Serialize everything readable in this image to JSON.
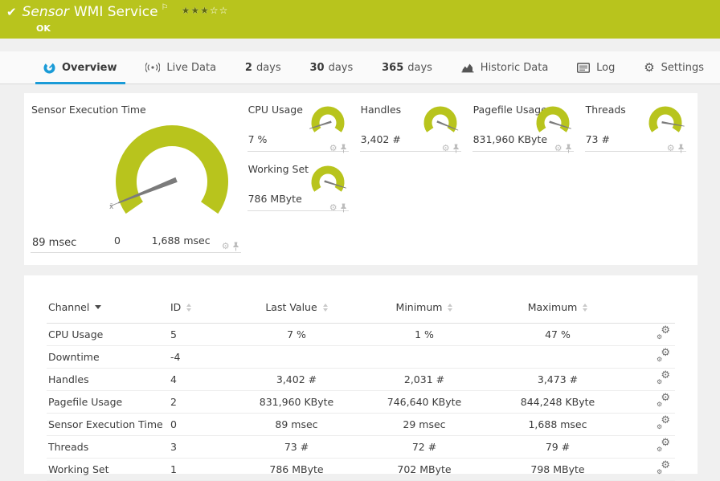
{
  "header": {
    "check_glyph": "✔",
    "title_prefix": "Sensor",
    "title": "WMI Service",
    "flag_glyph": "⚐",
    "status": "OK",
    "rating": {
      "filled": 3,
      "total": 5
    }
  },
  "tabs": [
    {
      "id": "overview",
      "icon": "gauge",
      "label": "Overview",
      "active": true
    },
    {
      "id": "live-data",
      "icon": "live",
      "label": "Live Data"
    },
    {
      "id": "2-days",
      "prefix": "2",
      "label": "days"
    },
    {
      "id": "30-days",
      "prefix": "30",
      "label": "days"
    },
    {
      "id": "365-days",
      "prefix": "365",
      "label": "days"
    },
    {
      "id": "historic-data",
      "icon": "chart",
      "label": "Historic Data"
    },
    {
      "id": "log",
      "icon": "log",
      "label": "Log"
    },
    {
      "id": "settings",
      "icon": "gear",
      "label": "Settings"
    }
  ],
  "gauges": {
    "primary": {
      "title": "Sensor Execution Time",
      "value": "89 msec",
      "min_label": "0",
      "max_label": "1,688 msec",
      "mean_glyph": "x̄",
      "fraction": 0.053
    },
    "small": [
      {
        "title": "CPU Usage",
        "value": "7 %",
        "fraction": 0.07
      },
      {
        "title": "Handles",
        "value": "3,402 #",
        "fraction": 0.95
      },
      {
        "title": "Pagefile Usage",
        "value": "831,960 KByte",
        "fraction": 0.93
      },
      {
        "title": "Threads",
        "value": "73 #",
        "fraction": 0.9
      },
      {
        "title": "Working Set",
        "value": "786 MByte",
        "fraction": 0.93
      }
    ]
  },
  "chart_data": {
    "type": "gauge",
    "gauges": [
      {
        "name": "Sensor Execution Time",
        "value": 89,
        "unit": "msec",
        "min": 0,
        "max": 1688
      },
      {
        "name": "CPU Usage",
        "value": 7,
        "unit": "%"
      },
      {
        "name": "Handles",
        "value": 3402,
        "unit": "#"
      },
      {
        "name": "Pagefile Usage",
        "value": 831960,
        "unit": "KByte"
      },
      {
        "name": "Threads",
        "value": 73,
        "unit": "#"
      },
      {
        "name": "Working Set",
        "value": 786,
        "unit": "MByte"
      }
    ]
  },
  "table": {
    "columns": [
      "Channel",
      "ID",
      "Last Value",
      "Minimum",
      "Maximum"
    ],
    "rows": [
      {
        "channel": "CPU Usage",
        "id": "5",
        "last": "7 %",
        "min": "1 %",
        "max": "47 %"
      },
      {
        "channel": "Downtime",
        "id": "-4",
        "last": "",
        "min": "",
        "max": ""
      },
      {
        "channel": "Handles",
        "id": "4",
        "last": "3,402 #",
        "min": "2,031 #",
        "max": "3,473 #"
      },
      {
        "channel": "Pagefile Usage",
        "id": "2",
        "last": "831,960 KByte",
        "min": "746,640 KByte",
        "max": "844,248 KByte"
      },
      {
        "channel": "Sensor Execution Time",
        "id": "0",
        "last": "89 msec",
        "min": "29 msec",
        "max": "1,688 msec"
      },
      {
        "channel": "Threads",
        "id": "3",
        "last": "73 #",
        "min": "72 #",
        "max": "79 #"
      },
      {
        "channel": "Working Set",
        "id": "1",
        "last": "786 MByte",
        "min": "702 MByte",
        "max": "798 MByte"
      }
    ]
  },
  "icons": {
    "gear": "⚙",
    "star_filled": "★",
    "star_empty": "☆"
  },
  "colors": {
    "ok_green": "#b8c41d",
    "accent_blue": "#1a9bd7",
    "needle_gray": "#7b7b7b",
    "page_bg": "#f0f0f0"
  }
}
